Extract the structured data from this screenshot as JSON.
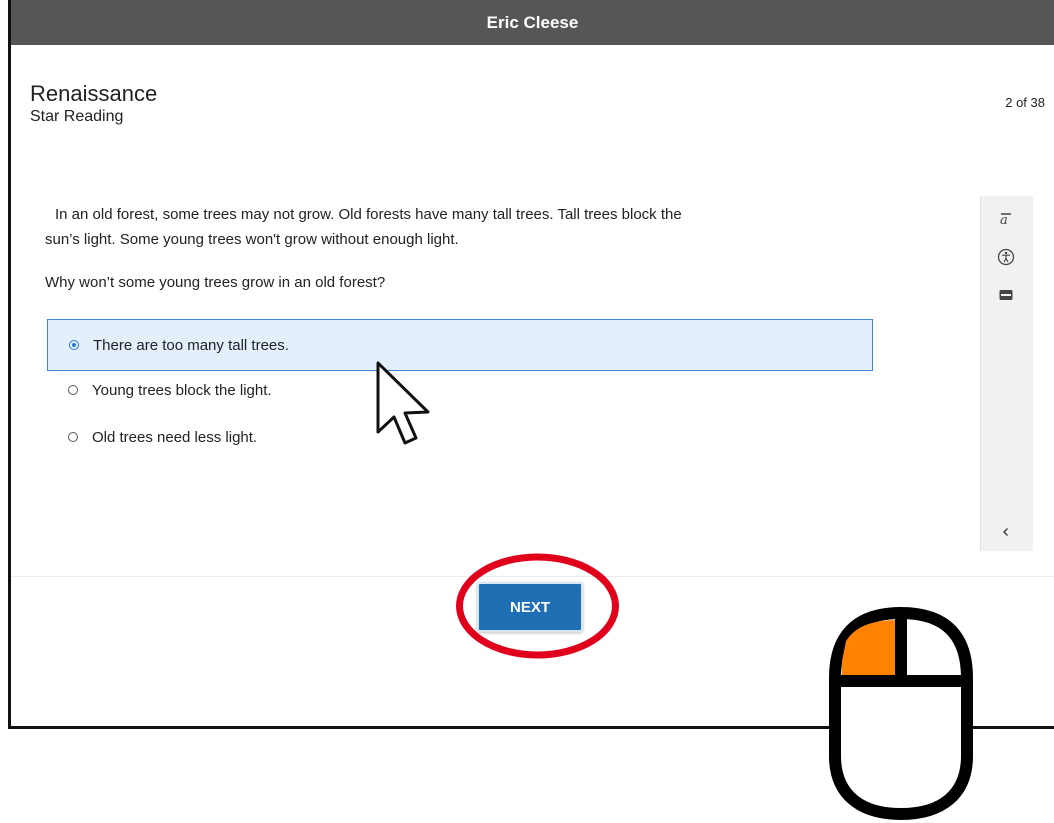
{
  "window": {
    "title": "Eric Cleese"
  },
  "brand": {
    "name": "Renaissance",
    "product": "Star Reading"
  },
  "progress": {
    "label": "2 of 38",
    "current": 2,
    "total": 38
  },
  "passage": "In an old forest, some trees may not grow. Old forests have many tall trees. Tall trees block the sun’s light. Some young trees won't grow without enough light.",
  "question": "Why won’t some young trees grow in an old forest?",
  "answers": [
    {
      "label": "There are too many tall trees.",
      "selected": true
    },
    {
      "label": "Young trees block the light.",
      "selected": false
    },
    {
      "label": "Old trees need less light.",
      "selected": false
    }
  ],
  "toolbar": {
    "tools": [
      "translate-icon",
      "accessibility-icon",
      "line-reader-icon",
      "collapse-chevron-icon"
    ]
  },
  "next_button": {
    "label": "NEXT"
  },
  "colors": {
    "title_bar": "#565656",
    "selected_answer_bg": "#e3f0fc",
    "selected_answer_border": "#3a8ad9",
    "next_button": "#1f6fb5",
    "highlight_ring": "#e0001b",
    "mouse_left_button": "#ff8200"
  }
}
